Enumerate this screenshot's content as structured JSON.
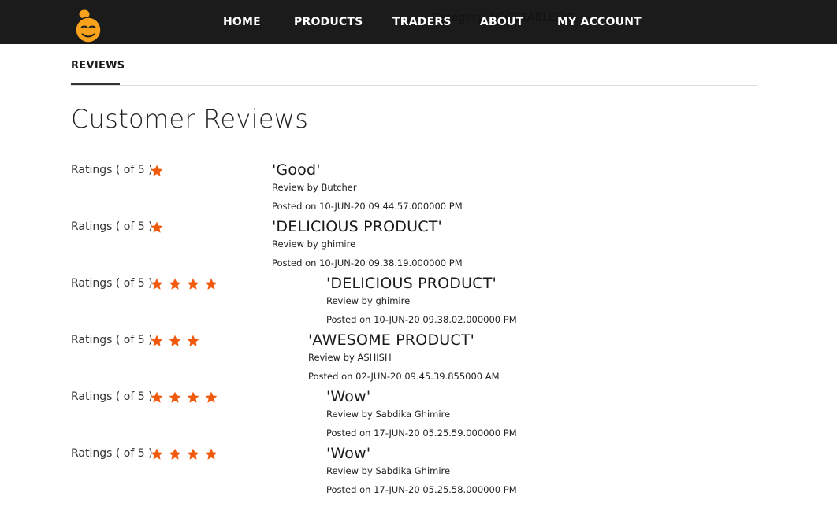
{
  "colors": {
    "navbar": "#1b1b1b",
    "star": "#f15a0d",
    "logo": "#f7a21a"
  },
  "nav": {
    "logo_icon": "chef-smiley-logo-icon",
    "links": [
      "HOME",
      "PRODUCTS",
      "TRADERS",
      "ABOUT",
      "MY ACCOUNT"
    ],
    "ghost_text": "Category: VEGETABLES/C"
  },
  "tab": {
    "label": "REVIEWS"
  },
  "title": "Customer Reviews",
  "reviews": [
    {
      "rating_label": "Ratings ( of 5 )",
      "stars": 1,
      "title": "'Good'",
      "by": "Review by Butcher",
      "date": "Posted on 10-JUN-20 09.44.57.000000 PM"
    },
    {
      "rating_label": "Ratings ( of 5 )",
      "stars": 1,
      "title": "'DELICIOUS PRODUCT'",
      "by": "Review by ghimire",
      "date": "Posted on 10-JUN-20 09.38.19.000000 PM"
    },
    {
      "rating_label": "Ratings ( of 5 )",
      "stars": 4,
      "title": "'DELICIOUS PRODUCT'",
      "by": "Review by ghimire",
      "date": "Posted on 10-JUN-20 09.38.02.000000 PM"
    },
    {
      "rating_label": "Ratings ( of 5 )",
      "stars": 3,
      "title": "'AWESOME PRODUCT'",
      "by": "Review by ASHISH",
      "date": "Posted on 02-JUN-20 09.45.39.855000 AM"
    },
    {
      "rating_label": "Ratings ( of 5 )",
      "stars": 4,
      "title": "'Wow'",
      "by": "Review by Sabdika Ghimire",
      "date": "Posted on 17-JUN-20 05.25.59.000000 PM"
    },
    {
      "rating_label": "Ratings ( of 5 )",
      "stars": 4,
      "title": "'Wow'",
      "by": "Review by Sabdika Ghimire",
      "date": "Posted on 17-JUN-20 05.25.58.000000 PM"
    }
  ]
}
